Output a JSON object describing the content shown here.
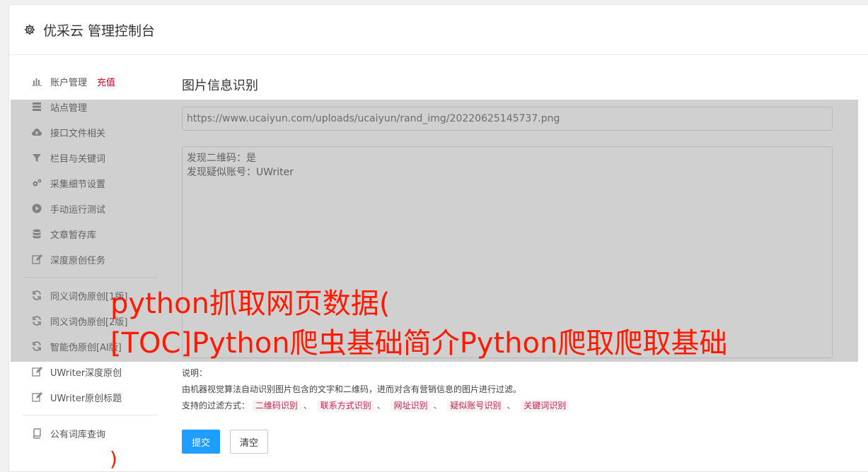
{
  "header": {
    "title": "优采云 管理控制台",
    "icon": "gear-icon"
  },
  "sidebar": {
    "items": [
      {
        "label": "账户管理",
        "badge": "充值",
        "icon": "bar-chart-icon"
      },
      {
        "label": "站点管理",
        "icon": "server-icon"
      },
      {
        "label": "接口文件相关",
        "icon": "cloud-upload-icon"
      },
      {
        "label": "栏目与关键词",
        "icon": "filter-icon"
      },
      {
        "label": "采集细节设置",
        "icon": "gears-icon"
      },
      {
        "label": "手动运行测试",
        "icon": "play-circle-icon"
      },
      {
        "label": "文章暂存库",
        "icon": "database-icon"
      },
      {
        "label": "深度原创任务",
        "icon": "edit-icon"
      },
      {
        "label": "同义词伪原创[1版]",
        "icon": "refresh-icon"
      },
      {
        "label": "同义词伪原创[2版]",
        "icon": "refresh-icon"
      },
      {
        "label": "智能伪原创[AI版]",
        "icon": "refresh-icon"
      },
      {
        "label": "UWriter深度原创",
        "icon": "edit-icon"
      },
      {
        "label": "UWriter原创标题",
        "icon": "edit-icon"
      },
      {
        "label": "公有词库查询",
        "icon": "book-icon"
      }
    ]
  },
  "main": {
    "title": "图片信息识别",
    "url_value": "https://www.ucaiyun.com/uploads/ucaiyun/rand_img/20220625145737.png",
    "result_value": "发现二维码：是\n发现疑似账号：UWriter",
    "notes": {
      "heading": "说明：",
      "description": "由机器视觉算法自动识别图片包含的文字和二维码，进而对含有营销信息的图片进行过滤。",
      "filter_label": "支持的过滤方式：",
      "separator": "、",
      "filters": [
        "二维码识别",
        "联系方式识别",
        "网址识别",
        "疑似账号识别",
        "关键词识别"
      ]
    },
    "submit_label": "提交",
    "clear_label": "清空"
  },
  "watermark": {
    "line1": "python抓取网页数据(",
    "line2": "[TOC]Python爬虫基础简介Python爬取爬取基础",
    "tail": ")"
  }
}
